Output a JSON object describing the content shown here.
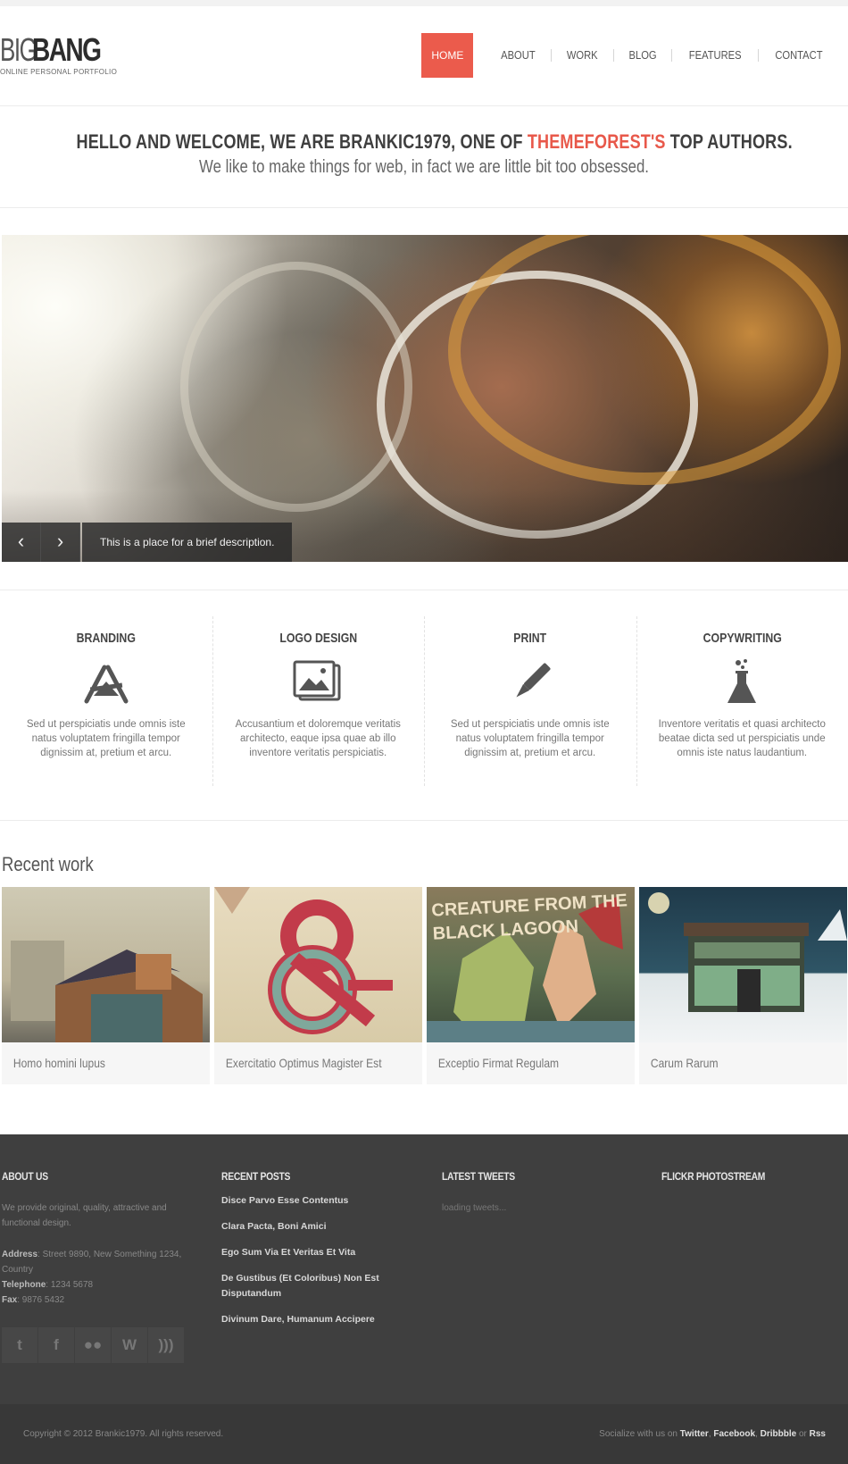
{
  "header": {
    "logo_light": "BIG",
    "logo_bold": "BANG",
    "tagline": "ONLINE PERSONAL PORTFOLIO",
    "nav": [
      {
        "label": "HOME",
        "active": true
      },
      {
        "label": "ABOUT",
        "active": false
      },
      {
        "label": "WORK",
        "active": false
      },
      {
        "label": "BLOG",
        "active": false
      },
      {
        "label": "FEATURES",
        "active": false
      },
      {
        "label": "CONTACT",
        "active": false
      }
    ]
  },
  "intro": {
    "title_before": "HELLO AND WELCOME, WE ARE BRANKIC1979, ONE OF ",
    "title_accent": "THEMEFOREST'S",
    "title_after": " TOP AUTHORS.",
    "subtitle": "We like to make things for web, in fact we are little bit too obsessed."
  },
  "slider": {
    "prev_icon": "‹",
    "next_icon": "›",
    "caption": "This is a place for a brief description."
  },
  "services": [
    {
      "title": "BRANDING",
      "icon": "branding-tools-icon",
      "text": "Sed ut perspiciatis unde omnis iste natus voluptatem fringilla tempor dignissim at, pretium et arcu."
    },
    {
      "title": "LOGO DESIGN",
      "icon": "image-gallery-icon",
      "text": "Accusantium et doloremque veritatis architecto, eaque ipsa quae ab illo inventore veritatis perspiciatis."
    },
    {
      "title": "PRINT",
      "icon": "pen-icon",
      "text": "Sed ut perspiciatis unde omnis iste natus voluptatem fringilla tempor dignissim at, pretium et arcu."
    },
    {
      "title": "COPYWRITING",
      "icon": "flask-icon",
      "text": "Inventore veritatis et quasi architecto beatae dicta sed ut perspiciatis unde omnis iste natus laudantium."
    }
  ],
  "recent_work": {
    "title": "Recent work",
    "items": [
      {
        "caption": "Homo homini lupus"
      },
      {
        "caption": "Exercitatio Optimus Magister Est"
      },
      {
        "caption": "Exceptio Firmat Regulam",
        "art_text": "CREATURE FROM THE BLACK LAGOON"
      },
      {
        "caption": "Carum Rarum"
      }
    ]
  },
  "footer": {
    "about": {
      "title": "ABOUT US",
      "text": "We provide original, quality, attractive and functional design.",
      "address_label": "Address",
      "address": ": Street 9890, New Something 1234, Country",
      "telephone_label": "Telephone",
      "telephone": ": 1234 5678",
      "fax_label": "Fax",
      "fax": ": 9876 5432",
      "socials": [
        "twitter-icon",
        "facebook-icon",
        "flickr-icon",
        "wordpress-icon",
        "rss-icon"
      ]
    },
    "recent_posts": {
      "title": "RECENT POSTS",
      "posts": [
        "Disce Parvo Esse Contentus",
        "Clara Pacta, Boni Amici",
        "Ego Sum Via Et Veritas Et Vita",
        "De Gustibus (Et Coloribus) Non Est Disputandum",
        "Divinum Dare, Humanum Accipere"
      ]
    },
    "tweets": {
      "title": "LATEST TWEETS",
      "status": "loading tweets..."
    },
    "flickr": {
      "title": "FLICKR PHOTOSTREAM"
    },
    "copyright": "Copyright © 2012 Brankic1979. All rights reserved.",
    "socialize_prefix": "Socialize with us on ",
    "socialize_links": [
      "Twitter",
      "Facebook",
      "Dribbble",
      "Rss"
    ],
    "socialize_or": " or "
  },
  "colors": {
    "accent": "#eb5b4c",
    "footer_bg": "#3f3f3f",
    "bottom_bg": "#383838"
  }
}
